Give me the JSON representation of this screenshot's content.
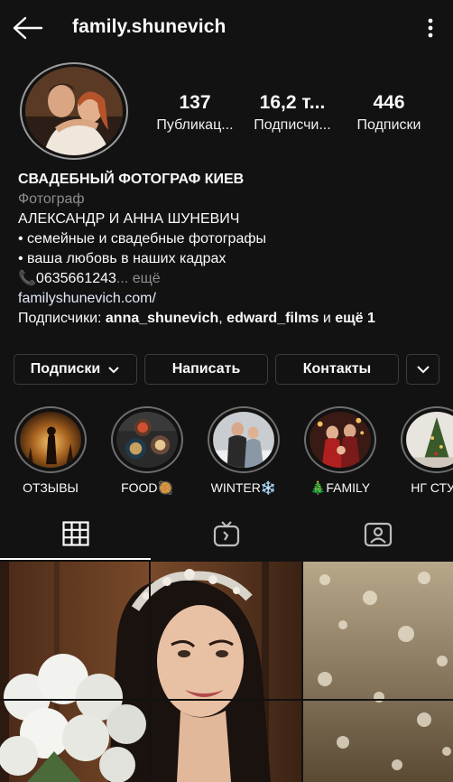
{
  "header": {
    "username": "family.shunevich"
  },
  "stats": [
    {
      "value": "137",
      "label": "Публикац..."
    },
    {
      "value": "16,2 т...",
      "label": "Подписчи..."
    },
    {
      "value": "446",
      "label": "Подписки"
    }
  ],
  "bio": {
    "title": "СВАДЕБНЫЙ ФОТОГРАФ КИЕВ",
    "category": "Фотограф",
    "line1": "АЛЕКСАНДР И АННА ШУНЕВИЧ",
    "line2": "• семейные и свадебные фотографы",
    "line3": "• ваша любовь в наших кадрах",
    "phone": "📞0635661243",
    "more": "... ещё",
    "website": "familyshunevich.com/",
    "followers_prefix": "Подписчики: ",
    "follower1": "anna_shunevich",
    "sep": ", ",
    "follower2": "edward_films",
    "and": " и ",
    "and_more": "ещё 1"
  },
  "buttons": {
    "following": "Подписки",
    "message": "Написать",
    "contacts": "Контакты"
  },
  "highlights": [
    {
      "label": "ОТЗЫВЫ"
    },
    {
      "label": "FOOD🥘"
    },
    {
      "label": "WINTER❄️"
    },
    {
      "label": "🎄FAMILY"
    },
    {
      "label": "НГ СТУД"
    }
  ],
  "tabs": [
    "grid",
    "igtv",
    "tagged"
  ]
}
